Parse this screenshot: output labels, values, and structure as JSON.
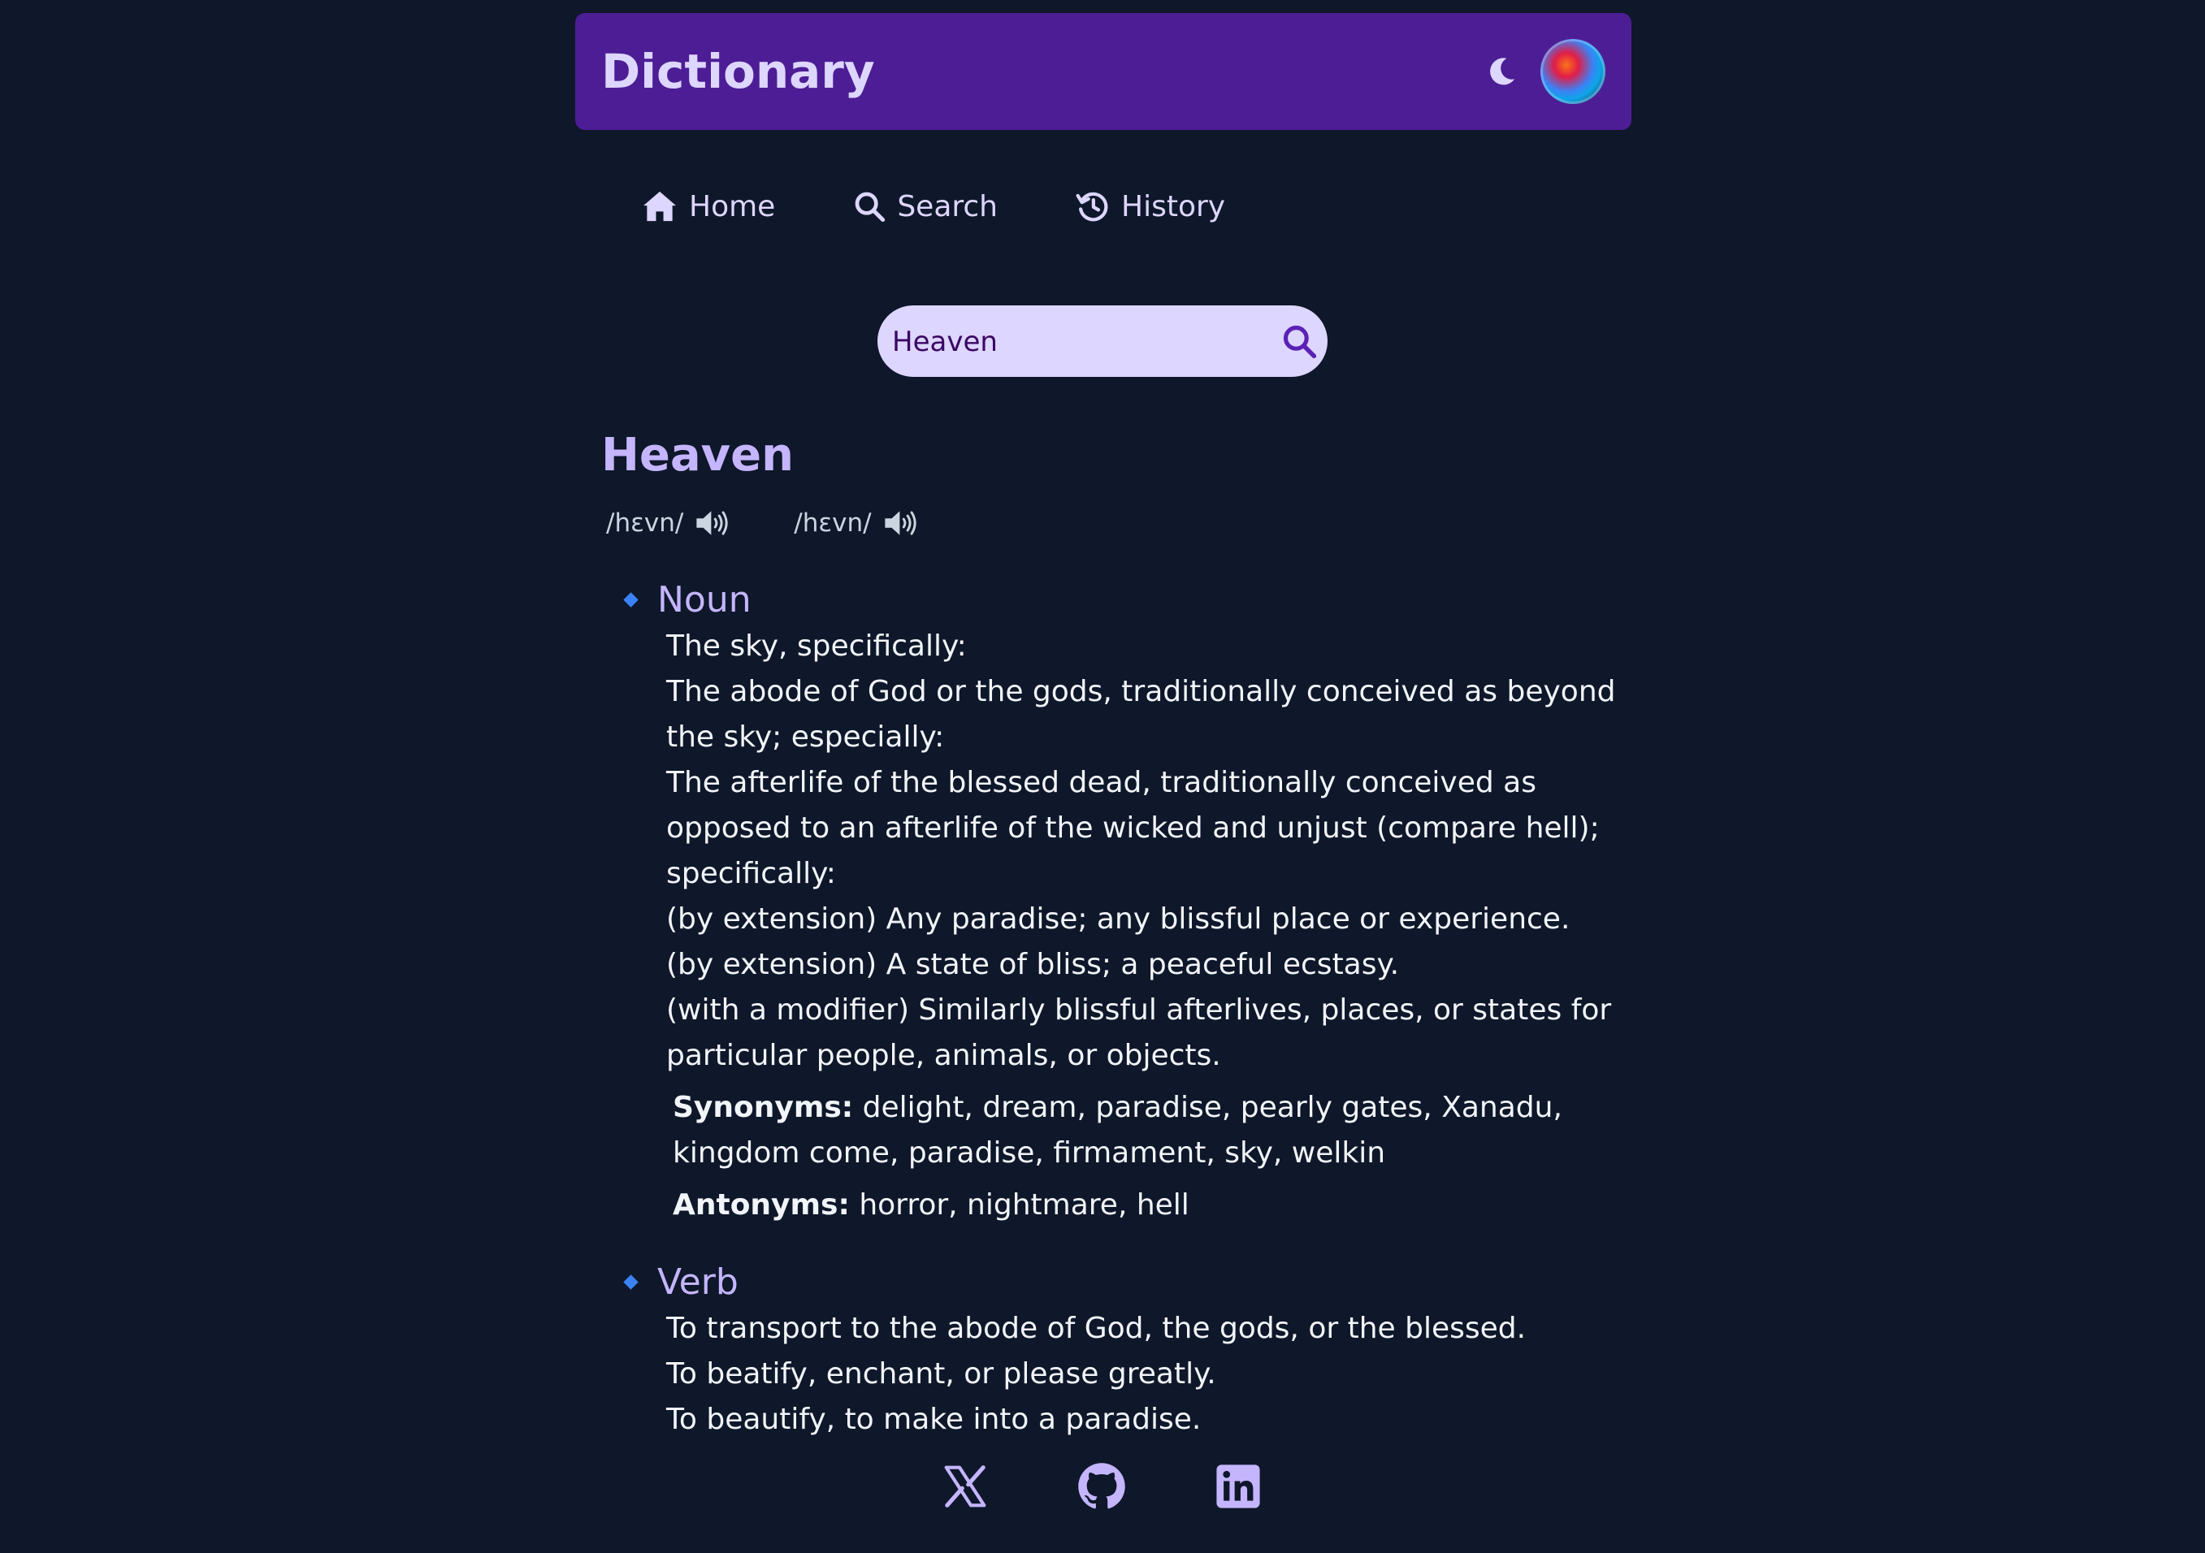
{
  "app": {
    "title": "Dictionary",
    "accent": "#4d1d96",
    "background": "#0f172a"
  },
  "nav": {
    "items": [
      {
        "label": "Home",
        "icon": "home-icon"
      },
      {
        "label": "Search",
        "icon": "search-icon"
      },
      {
        "label": "History",
        "icon": "history-icon"
      }
    ]
  },
  "search": {
    "value": "Heaven",
    "placeholder": ""
  },
  "entry": {
    "word": "Heaven",
    "phonetics": [
      "/hɛvn/",
      "/hɛvn/"
    ],
    "meanings": [
      {
        "pos": "Noun",
        "definitions": [
          "The sky, specifically:",
          "The abode of God or the gods, traditionally conceived as beyond the sky; especially:",
          "The afterlife of the blessed dead, traditionally conceived as opposed to an afterlife of the wicked and unjust (compare hell); specifically:",
          "(by extension) Any paradise; any blissful place or experience.",
          "(by extension) A state of bliss; a peaceful ecstasy.",
          "(with a modifier) Similarly blissful afterlives, places, or states for particular people, animals, or objects."
        ],
        "synonyms_label": "Synonyms:",
        "synonyms": "delight, dream, paradise, pearly gates, Xanadu, kingdom come, paradise, firmament, sky, welkin",
        "antonyms_label": "Antonyms:",
        "antonyms": "horror, nightmare, hell"
      },
      {
        "pos": "Verb",
        "definitions": [
          "To transport to the abode of God, the gods, or the blessed.",
          "To beatify, enchant, or please greatly.",
          "To beautify, to make into a paradise."
        ]
      }
    ]
  },
  "footer": {
    "social": [
      "x-icon",
      "github-icon",
      "linkedin-icon"
    ]
  }
}
